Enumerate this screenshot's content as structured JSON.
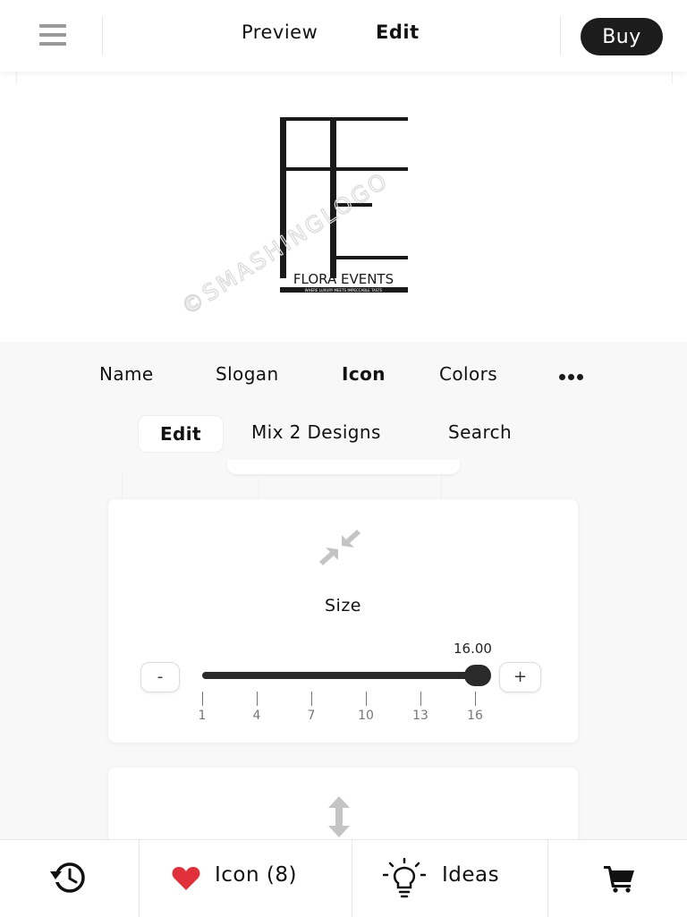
{
  "header": {
    "tabs": [
      {
        "label": "Preview",
        "active": false
      },
      {
        "label": "Edit",
        "active": true
      }
    ],
    "buy_label": "Buy"
  },
  "preview": {
    "logo": {
      "monogram": "FE",
      "company_name": "FLORA EVENTS",
      "slogan": "WHERE LUXURY MEETS IMPECCABLE TASTE",
      "watermark": "©SMASHINGLOGO"
    }
  },
  "category_tabs": [
    {
      "label": "Name",
      "active": false
    },
    {
      "label": "Slogan",
      "active": false
    },
    {
      "label": "Icon",
      "active": true
    },
    {
      "label": "Colors",
      "active": false
    }
  ],
  "sub_tabs": [
    {
      "label": "Edit",
      "active": true
    },
    {
      "label": "Mix 2 Designs",
      "active": false
    },
    {
      "label": "Search",
      "active": false
    }
  ],
  "size_control": {
    "title": "Size",
    "value": "16.00",
    "minus_label": "-",
    "plus_label": "+",
    "ticks": [
      "1",
      "4",
      "7",
      "10",
      "13",
      "16"
    ],
    "min": 1,
    "max": 16,
    "current": 16
  },
  "bottom_bar": {
    "icon_label": "Icon (8)",
    "ideas_label": "Ideas"
  },
  "colors": {
    "accent": "#1c1c1c",
    "heart": "#e0313b",
    "icon_gray": "#c4c4c4"
  }
}
